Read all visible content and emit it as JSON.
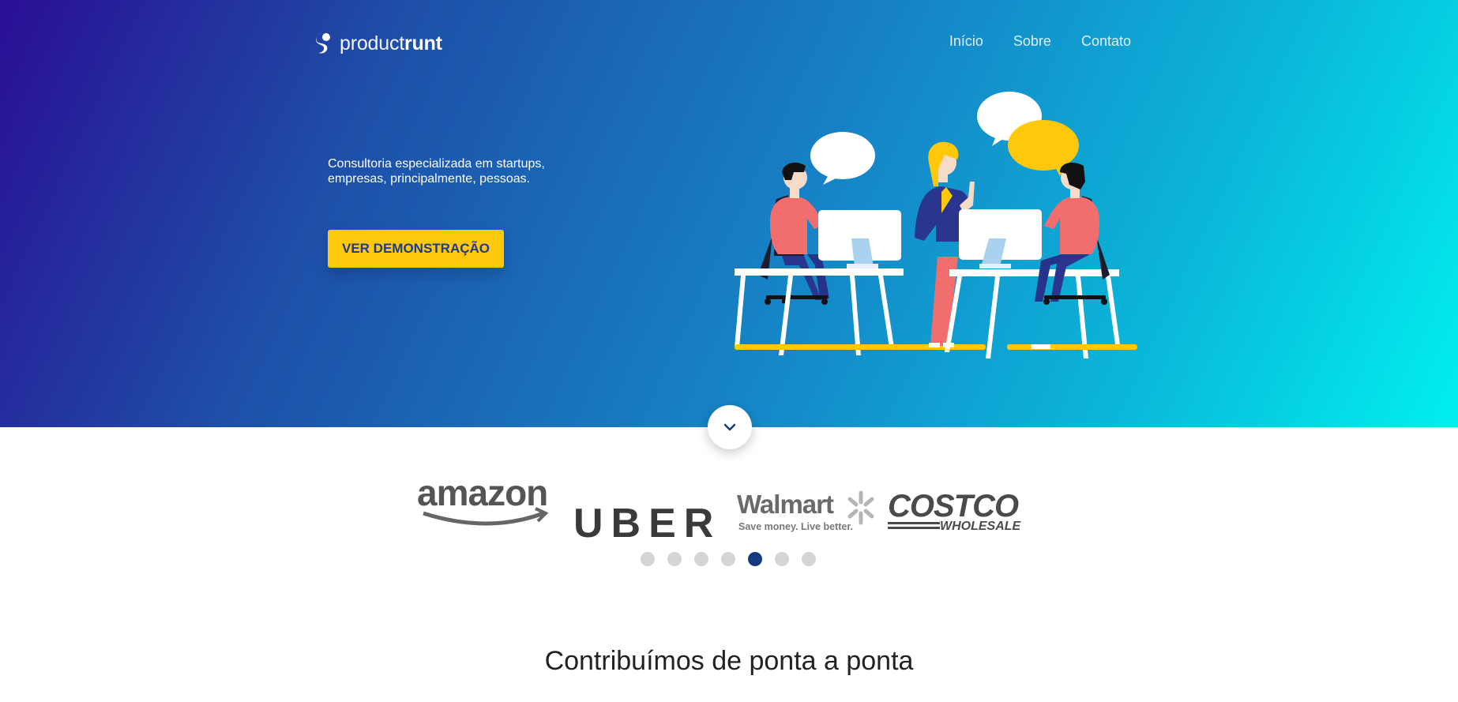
{
  "header": {
    "logo_light": "product",
    "logo_bold": "runt",
    "nav": [
      "Início",
      "Sobre",
      "Contato"
    ]
  },
  "hero": {
    "tagline": "Consultoria especializada em startups, empresas, principalmente, pessoas.",
    "cta_label": "VER DEMONSTRAÇÃO"
  },
  "clients": {
    "logos": [
      {
        "name": "amazon"
      },
      {
        "name": "UBER"
      },
      {
        "name": "Walmart",
        "sub": "Save money. Live better."
      },
      {
        "name": "COSTCO",
        "sub": "WHOLESALE"
      }
    ],
    "dots_total": 7,
    "active_dot": 5
  },
  "section": {
    "title": "Contribuímos de ponta a ponta"
  },
  "colors": {
    "accent": "#ffc80a",
    "brand_dark": "#163a82",
    "gradient_start": "#2a0e94",
    "gradient_end": "#00f0ee"
  }
}
